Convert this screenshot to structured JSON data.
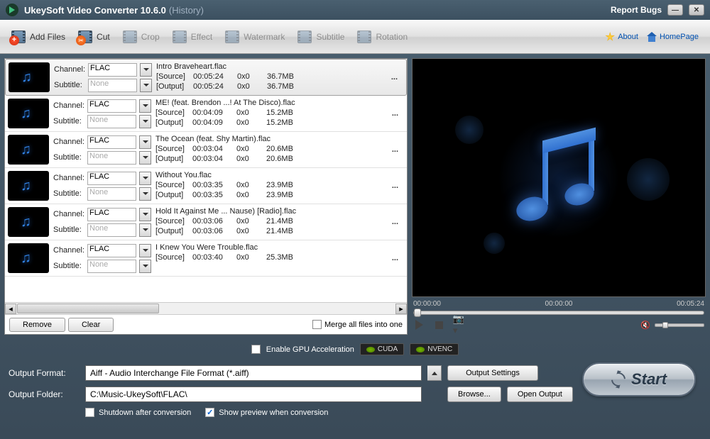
{
  "title": {
    "app": "UkeySoft Video Converter 10.6.0",
    "suffix": "(History)"
  },
  "titlebar": {
    "report": "Report Bugs"
  },
  "toolbar": {
    "add": "Add Files",
    "cut": "Cut",
    "crop": "Crop",
    "effect": "Effect",
    "watermark": "Watermark",
    "subtitle": "Subtitle",
    "rotation": "Rotation",
    "about": "About",
    "homepage": "HomePage"
  },
  "labels": {
    "channel": "Channel:",
    "subtitle": "Subtitle:",
    "none": "None",
    "src": "[Source]",
    "out": "[Output]"
  },
  "files": [
    {
      "name": "Intro Braveheart.flac",
      "channel": "FLAC",
      "src_dur": "00:05:24",
      "src_res": "0x0",
      "src_size": "36.7MB",
      "out_dur": "00:05:24",
      "out_res": "0x0",
      "out_size": "36.7MB",
      "more": "..."
    },
    {
      "name": "ME! (feat. Brendon ...! At The Disco).flac",
      "channel": "FLAC",
      "src_dur": "00:04:09",
      "src_res": "0x0",
      "src_size": "15.2MB",
      "out_dur": "00:04:09",
      "out_res": "0x0",
      "out_size": "15.2MB",
      "more": "..."
    },
    {
      "name": "The Ocean (feat. Shy Martin).flac",
      "channel": "FLAC",
      "src_dur": "00:03:04",
      "src_res": "0x0",
      "src_size": "20.6MB",
      "out_dur": "00:03:04",
      "out_res": "0x0",
      "out_size": "20.6MB",
      "more": "..."
    },
    {
      "name": "Without You.flac",
      "channel": "FLAC",
      "src_dur": "00:03:35",
      "src_res": "0x0",
      "src_size": "23.9MB",
      "out_dur": "00:03:35",
      "out_res": "0x0",
      "out_size": "23.9MB",
      "more": "..."
    },
    {
      "name": "Hold It Against Me ... Nause) [Radio].flac",
      "channel": "FLAC",
      "src_dur": "00:03:06",
      "src_res": "0x0",
      "src_size": "21.4MB",
      "out_dur": "00:03:06",
      "out_res": "0x0",
      "out_size": "21.4MB",
      "more": "..."
    },
    {
      "name": "I Knew You Were Trouble.flac",
      "channel": "FLAC",
      "src_dur": "00:03:40",
      "src_res": "0x0",
      "src_size": "25.3MB",
      "out_dur": "",
      "out_res": "",
      "out_size": "",
      "more": "..."
    }
  ],
  "footer": {
    "remove": "Remove",
    "clear": "Clear",
    "merge": "Merge all files into one"
  },
  "preview": {
    "t1": "00:00:00",
    "t2": "00:00:00",
    "t3": "00:05:24"
  },
  "gpu": {
    "enable": "Enable GPU Acceleration",
    "cuda": "CUDA",
    "nvenc": "NVENC"
  },
  "output": {
    "format_label": "Output Format:",
    "format_value": "Aiff - Audio Interchange File Format (*.aiff)",
    "folder_label": "Output Folder:",
    "folder_value": "C:\\Music-UkeySoft\\FLAC\\",
    "settings": "Output Settings",
    "browse": "Browse...",
    "open": "Open Output",
    "shutdown": "Shutdown after conversion",
    "preview": "Show preview when conversion"
  },
  "start": "Start"
}
